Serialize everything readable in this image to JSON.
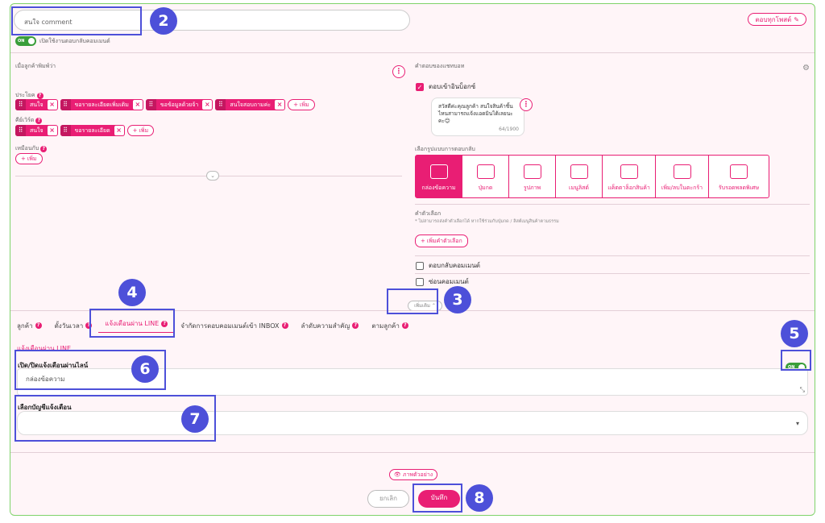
{
  "top": {
    "comment_placeholder": "สนใจ comment",
    "reply_all": "ตอบทุกโพสต์",
    "toggle_on": "ON",
    "toggle_label": "เปิดใช้งานตอบกลับคอมเมนต์"
  },
  "left": {
    "heading": "เมื่อลูกค้าพิมพ์ว่า",
    "sentence_label": "ประโยค",
    "sentence_chips": [
      "สนใจ",
      "ขอรายละเอียดเพิ่มเติม",
      "ขอข้อมูลด้วยจ้า",
      "สนใจสอบถามค่ะ"
    ],
    "keyword_label": "คีย์เวิร์ด",
    "keyword_chips": [
      "สนใจ",
      "ขอรายละเอียด"
    ],
    "similar_label": "เหมือนกับ",
    "add_label": "เพิ่ม"
  },
  "right": {
    "heading": "คำตอบของแชทบอท",
    "inbox_label": "ตอบเข้าอินบ็อกซ์",
    "bubble_text": "สวัสดีค่ะคุณลูกค้า สนใจสินค้าชิ้นไหนสามารถแจ้งแอดมินได้เลยนะคะ😊",
    "bubble_count": "64/1900",
    "type_heading": "เลือกรูปแบบการตอบกลับ",
    "types": [
      "กล่องข้อความ",
      "ปุ่มกด",
      "รูปภาพ",
      "เมนูลิสต์",
      "แค็ตตาล็อกสินค้า",
      "เพิ่ม/ลบในตะกร้า",
      "รับรอดพลดพิเศษ"
    ],
    "quick_heading": "คำตัวเลือก",
    "quick_note": "* ไม่สามารถส่งคำตัวเลือกได้ หากใช้ร่วมกับปุ่มกด / ลิสต์เมนูสินค้าตามธรรม",
    "add_quick": "เพิ่มคำตัวเลือก",
    "reply_comment": "ตอบกลับคอมเมนต์",
    "hide_comment": "ซ่อนคอมเมนต์"
  },
  "more_label": "เพิ่มเติม ⌃",
  "tabs": [
    "ลูกค้า",
    "ตั้งวันเวลา",
    "แจ้งเตือนผ่าน LINE",
    "จำกัดการตอบคอมเมนต์เข้า INBOX",
    "ลำดับความสำคัญ",
    "ตามลูกค้า"
  ],
  "line": {
    "section_title": "แจ้งเตือนผ่าน LINE",
    "toggle_label": "เปิด/ปิดแจ้งเตือนผ่านไลน์",
    "toggle_on": "ON",
    "message_placeholder": "กล่องข้อความ",
    "account_label": "เลือกบัญชีแจ้งเตือน"
  },
  "footer": {
    "preview": "ภาพตัวอย่าง",
    "cancel": "ยกเลิก",
    "save": "บันทึก"
  },
  "annotations": [
    "2",
    "3",
    "4",
    "5",
    "6",
    "7",
    "8"
  ],
  "colors": {
    "accent": "#e91e74",
    "annotation": "#4d50d9",
    "frame": "#7fd36a"
  }
}
